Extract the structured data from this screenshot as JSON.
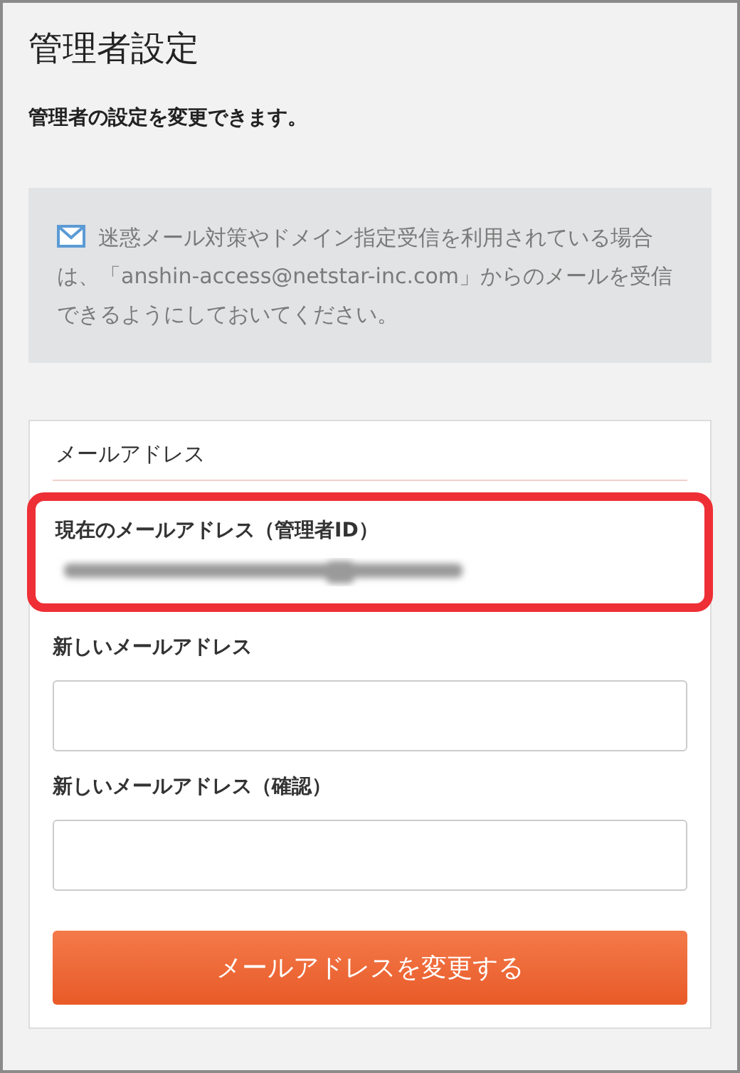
{
  "title": "管理者設定",
  "subtitle": "管理者の設定を変更できます。",
  "notice": {
    "text": "迷惑メール対策やドメイン指定受信を利用されている場合は、「anshin-access@netstar-inc.com」からのメールを受信できるようにしておいてください。"
  },
  "form": {
    "section_title": "メールアドレス",
    "current": {
      "label": "現在のメールアドレス（管理者ID）",
      "highlighted": true
    },
    "fields": [
      {
        "label": "新しいメールアドレス"
      },
      {
        "label": "新しいメールアドレス（確認）"
      }
    ],
    "submit": "メールアドレスを変更する"
  }
}
